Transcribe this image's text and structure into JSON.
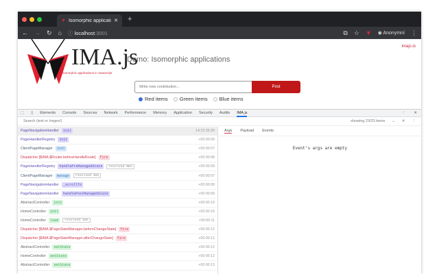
{
  "browser": {
    "tab_title": "Isomorphic applications feed – I",
    "url_host": "localhost",
    "url_port": ":3001",
    "profile": "Anonymní"
  },
  "page": {
    "brand": "IMA.js",
    "tagline": "Isomorphic applications in Javascript",
    "demo_title": "Demo: Isomorphic applications",
    "link": "imajs.io",
    "input_placeholder": "Write new contribution...",
    "post_label": "Post",
    "radios": [
      {
        "label": "Red items",
        "checked": true
      },
      {
        "label": "Green items",
        "checked": false
      },
      {
        "label": "Blue items",
        "checked": false
      }
    ]
  },
  "devtools": {
    "tabs": [
      "Elements",
      "Console",
      "Sources",
      "Network",
      "Performance",
      "Memory",
      "Application",
      "Security",
      "Audits",
      "IMA.js"
    ],
    "active_tab": "IMA.js",
    "search_placeholder": "Search (text or /regex/)",
    "count": "showing 23/23 items",
    "detail_tabs": [
      "Args",
      "Payload",
      "Events"
    ],
    "empty_msg": "Event's args are empty",
    "rows": [
      {
        "name": "PageNavigationHandler",
        "method": "init",
        "color": "purple",
        "time": "14:15:35.00",
        "selected": true
      },
      {
        "name": "PageHandlerRegistry",
        "method": "init",
        "color": "purple",
        "time": "+00:00:00"
      },
      {
        "name": "ClientPageManager",
        "method": "init",
        "color": "blue",
        "time": "+00:00:07"
      },
      {
        "name": "Dispatcher [$IMA.$Router.beforeHandleRoute]",
        "method": "fire",
        "color": "red",
        "time": "+00:00:08"
      },
      {
        "name": "PageHandlerRegistry",
        "method": "handlePreManagedState",
        "color": "purple",
        "note": "resolved 0ms",
        "time": "+00:00:09"
      },
      {
        "name": "ClientPageManager",
        "method": "manage",
        "color": "blue",
        "note": "resolved 1ms",
        "time": "+00:00:07"
      },
      {
        "name": "PageNavigationHandler",
        "method": "_scrollTo",
        "color": "purple",
        "time": "+00:00:09"
      },
      {
        "name": "PageNavigationHandler",
        "method": "handlePostManagedState",
        "color": "purple",
        "time": "+00:00:09"
      },
      {
        "name": "AbstractController",
        "method": "init",
        "color": "green",
        "time": "+00:00:10"
      },
      {
        "name": "HomeController",
        "method": "init",
        "color": "green",
        "time": "+00:00:10"
      },
      {
        "name": "HomeController",
        "method": "load",
        "color": "green",
        "note": "resolved 1ms",
        "time": "+00:00:11"
      },
      {
        "name": "Dispatcher [$IMA.$PageStateManager.beforeChangeState]",
        "method": "fire",
        "color": "red",
        "time": "+00:00:12"
      },
      {
        "name": "Dispatcher [$IMA.$PageStateManager.afterChangeState]",
        "method": "fire",
        "color": "red",
        "time": "+00:00:12"
      },
      {
        "name": "AbstractController",
        "method": "setState",
        "color": "green",
        "time": "+00:00:12"
      },
      {
        "name": "HomeController",
        "method": "setState",
        "color": "green",
        "time": "+00:00:12"
      },
      {
        "name": "AbstractController",
        "method": "setState",
        "color": "green",
        "time": "+00:00:13"
      }
    ]
  }
}
